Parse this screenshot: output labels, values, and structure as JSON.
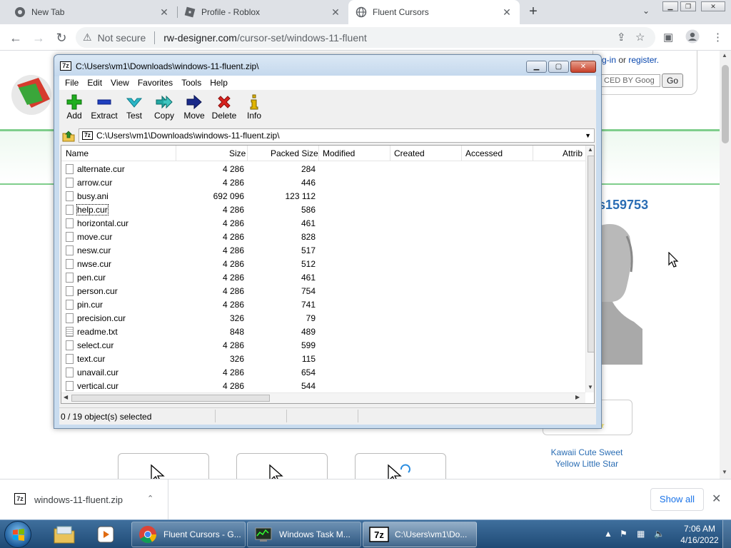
{
  "browser": {
    "tabs": [
      {
        "title": "New Tab"
      },
      {
        "title": "Profile - Roblox"
      },
      {
        "title": "Fluent Cursors"
      }
    ],
    "address": {
      "security_label": "Not secure",
      "url_domain": "rw-designer.com",
      "url_path": "/cursor-set/windows-11-fluent"
    }
  },
  "page": {
    "login_text": "g-in",
    "login_or": "or",
    "register_link": "register.",
    "search_placeholder": "CED BY Goog",
    "go_label": "Go",
    "username": "s159753",
    "kawaii_caption_line1": "Kawaii Cute Sweet",
    "kawaii_caption_line2": "Yellow Little Star"
  },
  "zip": {
    "title": "C:\\Users\\vm1\\Downloads\\windows-11-fluent.zip\\",
    "menu": [
      "File",
      "Edit",
      "View",
      "Favorites",
      "Tools",
      "Help"
    ],
    "tools": [
      {
        "label": "Add",
        "icon": "plus-icon",
        "color": "#1fae1f"
      },
      {
        "label": "Extract",
        "icon": "minus-icon",
        "color": "#1f3fbf"
      },
      {
        "label": "Test",
        "icon": "check-icon",
        "color": "#2bb6c7"
      },
      {
        "label": "Copy",
        "icon": "double-arrow-icon",
        "color": "#22a7a3"
      },
      {
        "label": "Move",
        "icon": "arrow-right-icon",
        "color": "#1a2a8a"
      },
      {
        "label": "Delete",
        "icon": "x-icon",
        "color": "#d8231f"
      },
      {
        "label": "Info",
        "icon": "info-icon",
        "color": "#e0b400"
      }
    ],
    "path": "C:\\Users\\vm1\\Downloads\\windows-11-fluent.zip\\",
    "columns": [
      "Name",
      "Size",
      "Packed Size",
      "Modified",
      "Created",
      "Accessed",
      "Attrib"
    ],
    "files": [
      {
        "name": "alternate.cur",
        "size": "4 286",
        "packed": "284"
      },
      {
        "name": "arrow.cur",
        "size": "4 286",
        "packed": "446"
      },
      {
        "name": "busy.ani",
        "size": "692 096",
        "packed": "123 112"
      },
      {
        "name": "help.cur",
        "size": "4 286",
        "packed": "586"
      },
      {
        "name": "horizontal.cur",
        "size": "4 286",
        "packed": "461"
      },
      {
        "name": "move.cur",
        "size": "4 286",
        "packed": "828"
      },
      {
        "name": "nesw.cur",
        "size": "4 286",
        "packed": "517"
      },
      {
        "name": "nwse.cur",
        "size": "4 286",
        "packed": "512"
      },
      {
        "name": "pen.cur",
        "size": "4 286",
        "packed": "461"
      },
      {
        "name": "person.cur",
        "size": "4 286",
        "packed": "754"
      },
      {
        "name": "pin.cur",
        "size": "4 286",
        "packed": "741"
      },
      {
        "name": "precision.cur",
        "size": "326",
        "packed": "79"
      },
      {
        "name": "readme.txt",
        "size": "848",
        "packed": "489"
      },
      {
        "name": "select.cur",
        "size": "4 286",
        "packed": "599"
      },
      {
        "name": "text.cur",
        "size": "326",
        "packed": "115"
      },
      {
        "name": "unavail.cur",
        "size": "4 286",
        "packed": "654"
      },
      {
        "name": "vertical.cur",
        "size": "4 286",
        "packed": "544"
      }
    ],
    "status": "0 / 19 object(s) selected"
  },
  "downloads": {
    "file_name": "windows-11-fluent.zip",
    "show_all": "Show all"
  },
  "taskbar": {
    "tasks": [
      {
        "label": "Fluent Cursors - G..."
      },
      {
        "label": "Windows Task M..."
      },
      {
        "label": "C:\\Users\\vm1\\Do..."
      }
    ],
    "clock_time": "7:06 AM",
    "clock_date": "4/16/2022"
  }
}
